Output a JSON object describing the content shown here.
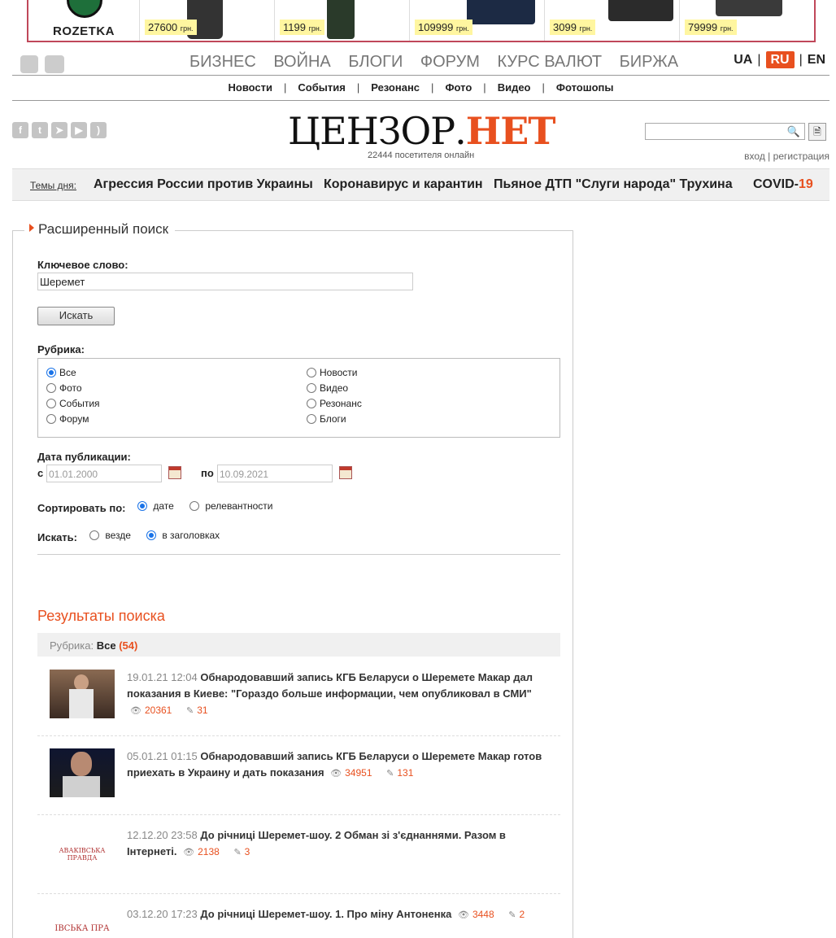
{
  "ad": {
    "brand": "ROZETKA",
    "items": [
      {
        "price": "27600",
        "unit": "грн."
      },
      {
        "price": "1199",
        "unit": "грн."
      },
      {
        "price": "109999",
        "unit": "грн."
      },
      {
        "price": "3099",
        "unit": "грн."
      },
      {
        "price": "79999",
        "unit": "грн."
      }
    ]
  },
  "main_nav": [
    "БИЗНЕС",
    "ВОЙНА",
    "БЛОГИ",
    "ФОРУМ",
    "КУРС ВАЛЮТ",
    "БИРЖА"
  ],
  "langs": {
    "ua": "UA",
    "ru": "RU",
    "en": "EN",
    "sep": "|"
  },
  "sub_nav": [
    "Новости",
    "События",
    "Резонанс",
    "Фото",
    "Видео",
    "Фотошопы"
  ],
  "sub_nav_sep": "|",
  "logo": {
    "part1": "ЦЕНЗОР.",
    "part2": "НЕТ"
  },
  "online": "22444 посетителя онлайн",
  "auth": {
    "login": "вход",
    "sep": "|",
    "register": "регистрация"
  },
  "topics": {
    "label": "Темы дня:",
    "items": [
      "Агрессия России против Украины",
      "Коронавирус и карантин",
      "Пьяное ДТП \"Слуги народа\" Трухина"
    ],
    "covid": "COVID-",
    "covid_num": "19"
  },
  "form": {
    "title": "Расширенный поиск",
    "keyword_label": "Ключевое слово:",
    "keyword_value": "Шеремет",
    "search_button": "Искать",
    "rubric_label": "Рубрика:",
    "rubrics_left": [
      "Все",
      "Фото",
      "События",
      "Форум"
    ],
    "rubrics_right": [
      "Новости",
      "Видео",
      "Резонанс",
      "Блоги"
    ],
    "rubric_selected": "Все",
    "date_label": "Дата публикации:",
    "from_label": "с",
    "from_value": "01.01.2000",
    "to_label": "по",
    "to_value": "10.09.2021",
    "sort_label": "Сортировать по:",
    "sort_date": "дате",
    "sort_rel": "релевантности",
    "where_label": "Искать:",
    "where_all": "везде",
    "where_titles": "в заголовках"
  },
  "results": {
    "title": "Результаты поиска",
    "rubric_label": "Рубрика:",
    "rubric_value": "Все",
    "count": "(54)",
    "items": [
      {
        "date": "19.01.21 12:04",
        "title": "Обнародовавший запись КГБ Беларуси о Шеремете Макар дал показания в Киеве: \"Гораздо больше информации, чем опубликовал в СМИ\"",
        "views": "20361",
        "comments": "31"
      },
      {
        "date": "05.01.21 01:15",
        "title": "Обнародовавший запись КГБ Беларуси о Шеремете Макар готов приехать в Украину и дать показания",
        "views": "34951",
        "comments": "131"
      },
      {
        "date": "12.12.20 23:58",
        "title": "До річниці Шеремет-шоу. 2 Обман зі з'єднаннями. Разом в Інтернеті.",
        "views": "2138",
        "comments": "3"
      },
      {
        "date": "03.12.20 17:23",
        "title": "До річниці Шеремет-шоу. 1. Про міну Антоненка",
        "views": "3448",
        "comments": "2"
      }
    ],
    "thumb3_text": "АВАКІВСЬКА ПРАВДА",
    "thumb4_text": "ІВСЬКА ПРА"
  }
}
